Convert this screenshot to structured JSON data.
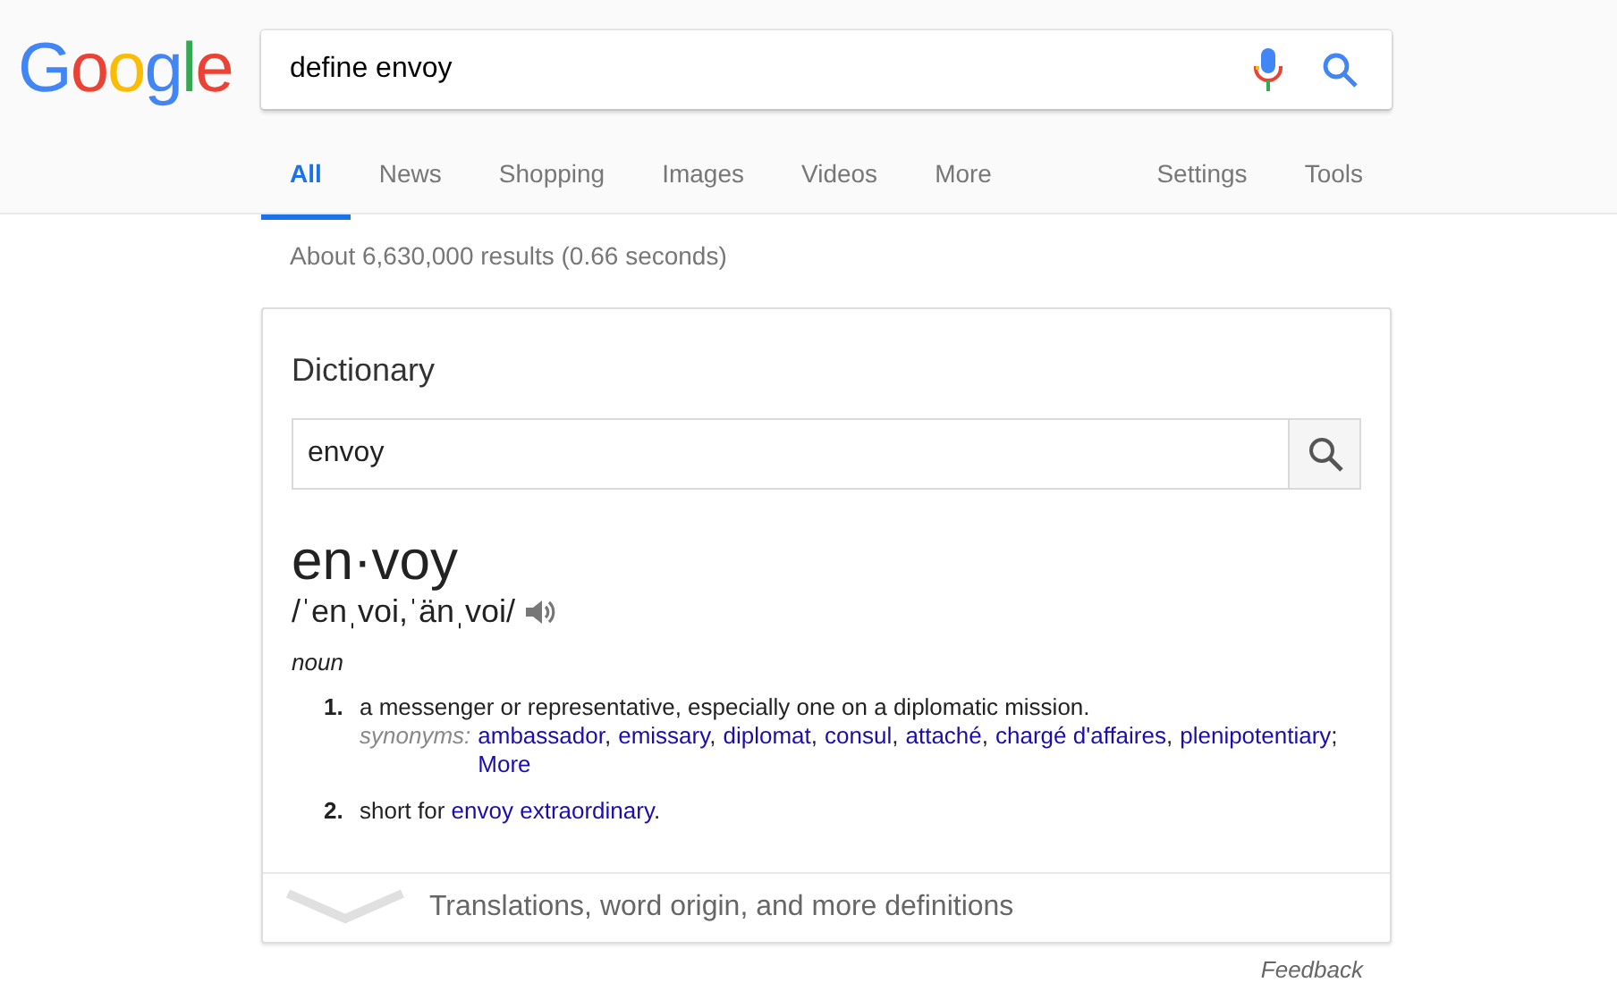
{
  "logo": {
    "text": "Google"
  },
  "search": {
    "value": "define envoy"
  },
  "tabs": [
    {
      "label": "All",
      "selected": true
    },
    {
      "label": "News",
      "selected": false
    },
    {
      "label": "Shopping",
      "selected": false
    },
    {
      "label": "Images",
      "selected": false
    },
    {
      "label": "Videos",
      "selected": false
    },
    {
      "label": "More",
      "selected": false
    }
  ],
  "tools": [
    "Settings",
    "Tools"
  ],
  "result_stats": "About 6,630,000 results (0.66 seconds)",
  "dictionary": {
    "title": "Dictionary",
    "search_value": "envoy",
    "headword": "en·voy",
    "pronunciation": "/ˈenˌvoi,ˈänˌvoi/",
    "part_of_speech": "noun",
    "definitions": [
      {
        "number": "1.",
        "text": "a messenger or representative, especially one on a diplomatic mission.",
        "synonyms_label": "synonyms:",
        "synonyms": [
          {
            "word": "ambassador",
            "punct": ","
          },
          {
            "word": "emissary",
            "punct": ","
          },
          {
            "word": "diplomat",
            "punct": ","
          },
          {
            "word": "consul",
            "punct": ","
          },
          {
            "word": "attaché",
            "punct": ","
          },
          {
            "word": "chargé d'affaires",
            "punct": ","
          },
          {
            "word": "plenipotentiary",
            "punct": ";"
          }
        ],
        "more": "More"
      },
      {
        "number": "2.",
        "text": "short for ",
        "link": "envoy extraordinary",
        "after": "."
      }
    ],
    "expand_label": "Translations, word origin, and more definitions"
  },
  "feedback": "Feedback"
}
